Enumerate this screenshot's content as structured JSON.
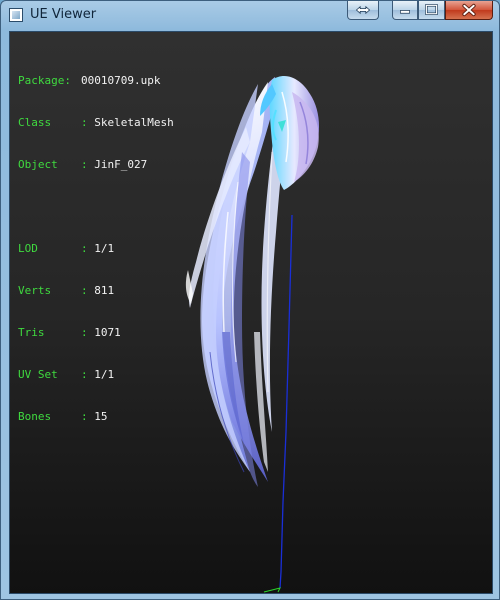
{
  "window": {
    "title": "UE Viewer",
    "buttons": {
      "swap_icon": "swap-arrows-icon",
      "minimize_icon": "minimize-icon",
      "maximize_icon": "maximize-icon",
      "close_icon": "close-icon"
    }
  },
  "info": {
    "package": {
      "label": "Package:",
      "value": "00010709.upk"
    },
    "class": {
      "label": "Class",
      "colon": ":",
      "value": "SkeletalMesh"
    },
    "object": {
      "label": "Object",
      "colon": ":",
      "value": "JinF_027"
    },
    "lod": {
      "label": "LOD",
      "colon": ":",
      "value": "1/1"
    },
    "verts": {
      "label": "Verts",
      "colon": ":",
      "value": "811"
    },
    "tris": {
      "label": "Tris",
      "colon": ":",
      "value": "1071"
    },
    "uvset": {
      "label": "UV Set",
      "colon": ":",
      "value": "1/1"
    },
    "bones": {
      "label": "Bones",
      "colon": ":",
      "value": "15"
    }
  },
  "colors": {
    "label_green": "#3fda3f",
    "value_white": "#f2f2f2",
    "viewport_bg": "#262626",
    "bone_line_blue": "#1a2fd8",
    "hair_tint": "#9fb4ff"
  }
}
